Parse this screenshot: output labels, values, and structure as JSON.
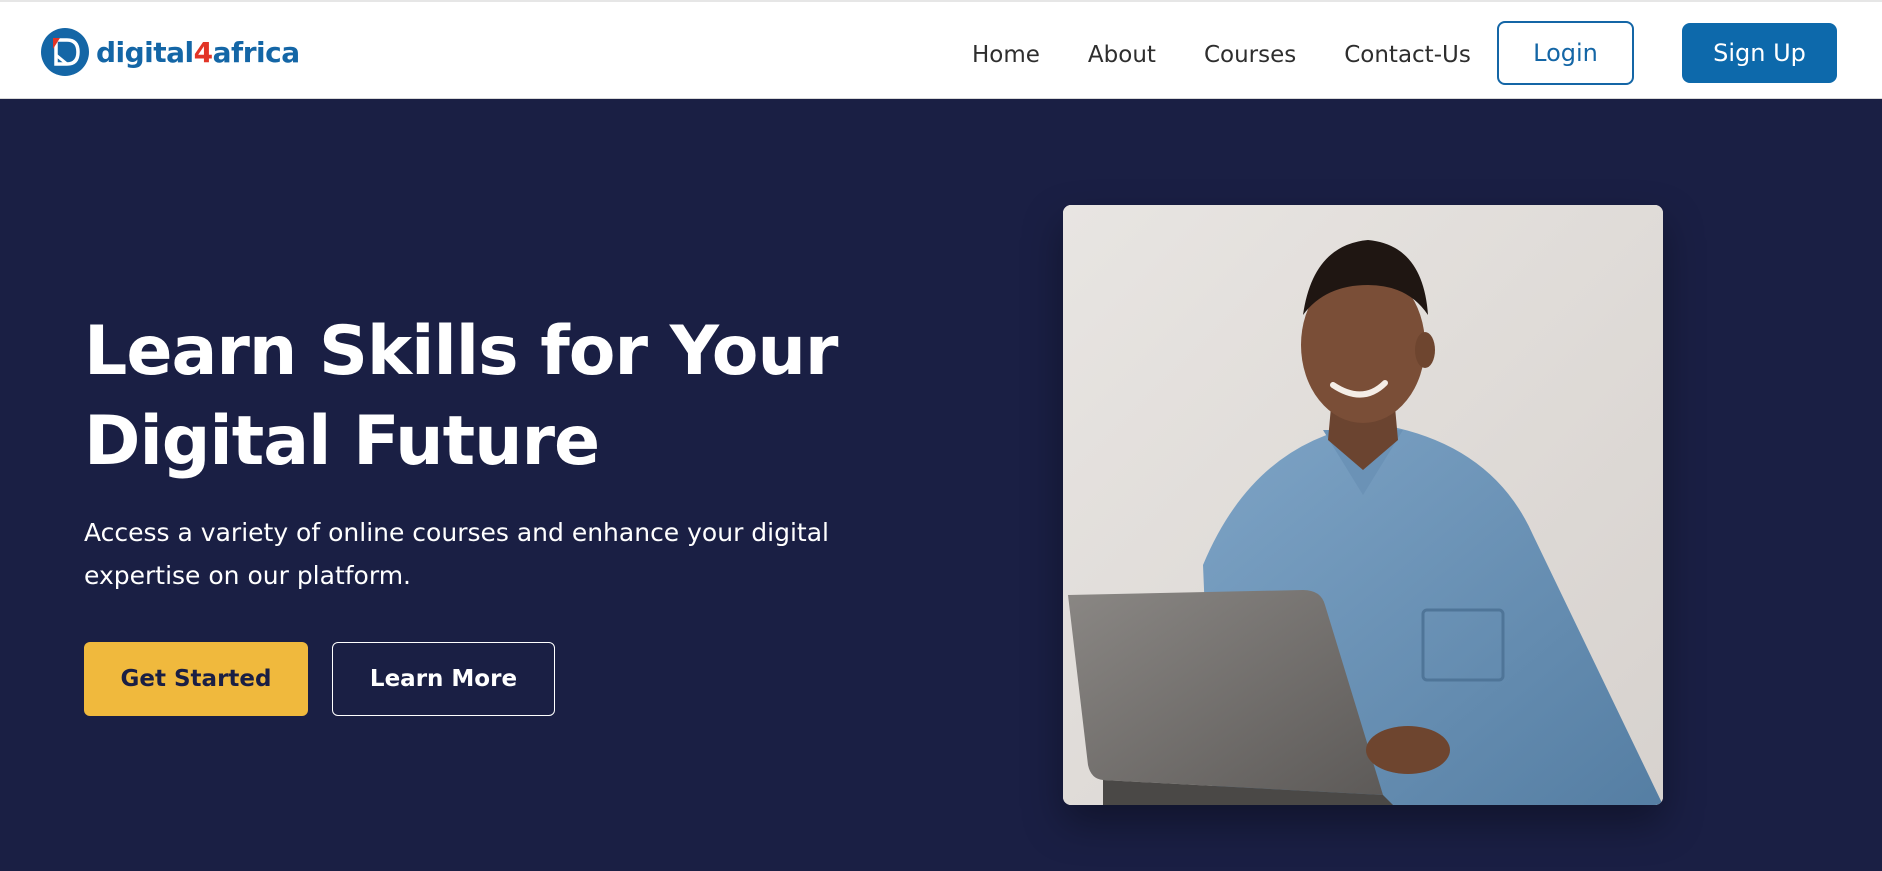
{
  "brand": {
    "name_prefix": "digital",
    "name_number": "4",
    "name_suffix": "africa",
    "logo_icon": "digital4africa-logo-icon",
    "primary_color": "#1466a6",
    "accent_color": "#e23426"
  },
  "nav": {
    "items": [
      {
        "label": "Home"
      },
      {
        "label": "About"
      },
      {
        "label": "Courses"
      },
      {
        "label": "Contact-Us"
      }
    ],
    "login_label": "Login",
    "signup_label": "Sign Up"
  },
  "hero": {
    "title_line1": "Learn Skills for Your",
    "title_line2": "Digital Future",
    "subtitle_line1": "Access a variety of online courses and enhance your digital",
    "subtitle_line2": "expertise on our platform.",
    "primary_cta": "Get Started",
    "secondary_cta": "Learn More",
    "background_color": "#1a1f44",
    "primary_cta_color": "#f0b93d"
  }
}
